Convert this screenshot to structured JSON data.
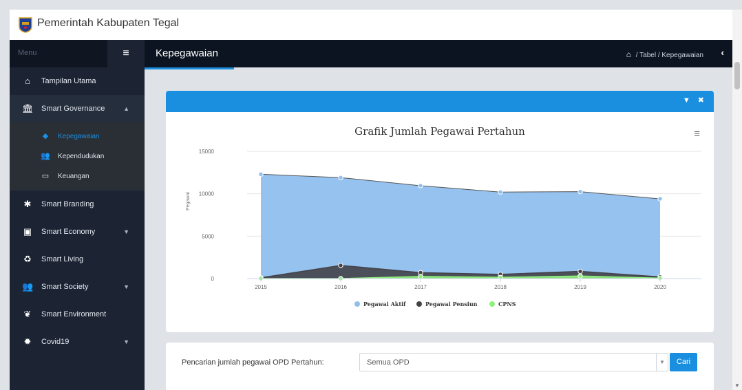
{
  "app": {
    "title": "Pemerintah Kabupaten Tegal"
  },
  "sidebar": {
    "menu_label": "Menu",
    "items": [
      {
        "label": "Tampilan Utama",
        "icon": "home-icon"
      },
      {
        "label": "Smart Governance",
        "icon": "institution-icon"
      },
      {
        "label": "Smart Branding",
        "icon": "asterisk-icon"
      },
      {
        "label": "Smart Economy",
        "icon": "money-icon"
      },
      {
        "label": "Smart Living",
        "icon": "recycle-icon"
      },
      {
        "label": "Smart Society",
        "icon": "users-icon"
      },
      {
        "label": "Smart Environment",
        "icon": "leaf-icon"
      },
      {
        "label": "Covid19",
        "icon": "virus-icon"
      }
    ],
    "sub_items": [
      {
        "label": "Kepegawaian",
        "icon": "tag-icon"
      },
      {
        "label": "Kependudukan",
        "icon": "users-icon"
      },
      {
        "label": "Keuangan",
        "icon": "credit-card-icon"
      }
    ]
  },
  "header": {
    "title": "Kepegawaian",
    "breadcrumb": {
      "sep": "/",
      "b1": "Tabel",
      "b2": "Kepegawaian"
    }
  },
  "chart_data": {
    "type": "area",
    "title": "Grafik Jumlah Pegawai Pertahun",
    "ylabel": "Pegawai",
    "categories": [
      "2015",
      "2016",
      "2017",
      "2018",
      "2019",
      "2020"
    ],
    "ylim": [
      0,
      15000
    ],
    "yticks": [
      "0",
      "5000",
      "10000",
      "15000"
    ],
    "series": [
      {
        "name": "Pegawai Aktif",
        "color": "#90bfee",
        "values": [
          12300,
          11900,
          10950,
          10200,
          10250,
          9400
        ]
      },
      {
        "name": "Pegawai Pensiun",
        "color": "#434348",
        "values": [
          100,
          1550,
          700,
          500,
          850,
          200
        ]
      },
      {
        "name": "CPNS",
        "color": "#90ee7e",
        "values": [
          0,
          0,
          250,
          150,
          300,
          50
        ]
      }
    ]
  },
  "search": {
    "label": "Pencarian jumlah pegawai OPD Pertahun:",
    "selected": "Semua OPD",
    "button": "Cari"
  }
}
